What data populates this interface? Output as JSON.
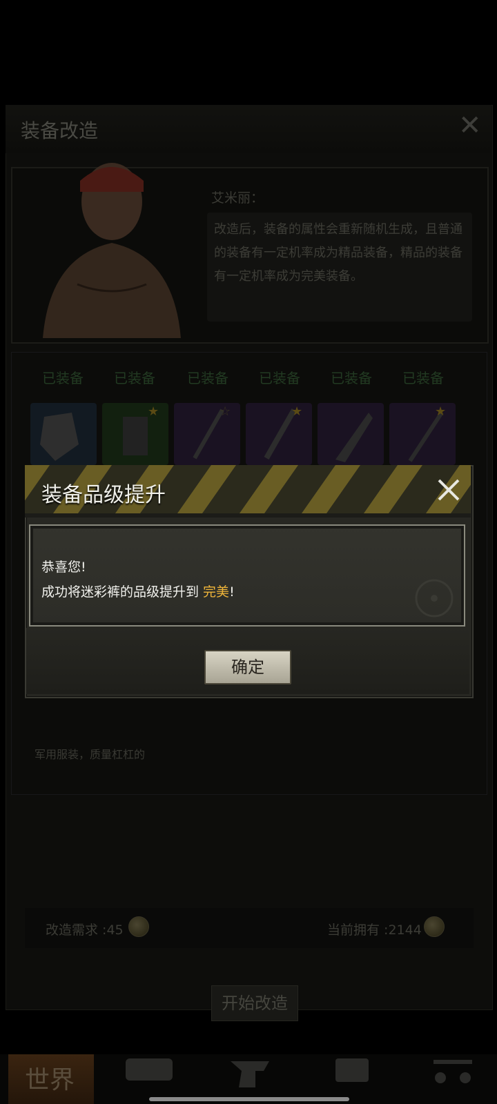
{
  "background": {
    "title": "装备改造",
    "npc": {
      "name": "艾米丽：",
      "speech": "改造后，装备的属性会重新随机生成，且普通的装备有一定机率成为精品装备，精品的装备有一定机率成为完美装备。"
    },
    "equip_tags": [
      "已装备",
      "已装备",
      "已装备",
      "已装备",
      "已装备",
      "已装备"
    ],
    "description": "军用服装，质量杠杠的",
    "requirement_label": "改造需求 :45",
    "owned_label": "当前拥有 :2144",
    "start_button": "开始改造",
    "nav_world": "世界"
  },
  "dialog": {
    "title": "装备品级提升",
    "line1": "恭喜您!",
    "line2_prefix": "成功将迷彩裤的品级提升到 ",
    "line2_highlight": "完美",
    "line2_suffix": "!",
    "confirm_label": "确定"
  },
  "colors": {
    "highlight": "#f2b73a",
    "dialog_bg": "#272722",
    "hazard_yellow": "#b8a030"
  },
  "icons": [
    "close-icon",
    "coin-icon",
    "lock-icon",
    "star-icon",
    "shield-icon",
    "radiation-icon"
  ]
}
